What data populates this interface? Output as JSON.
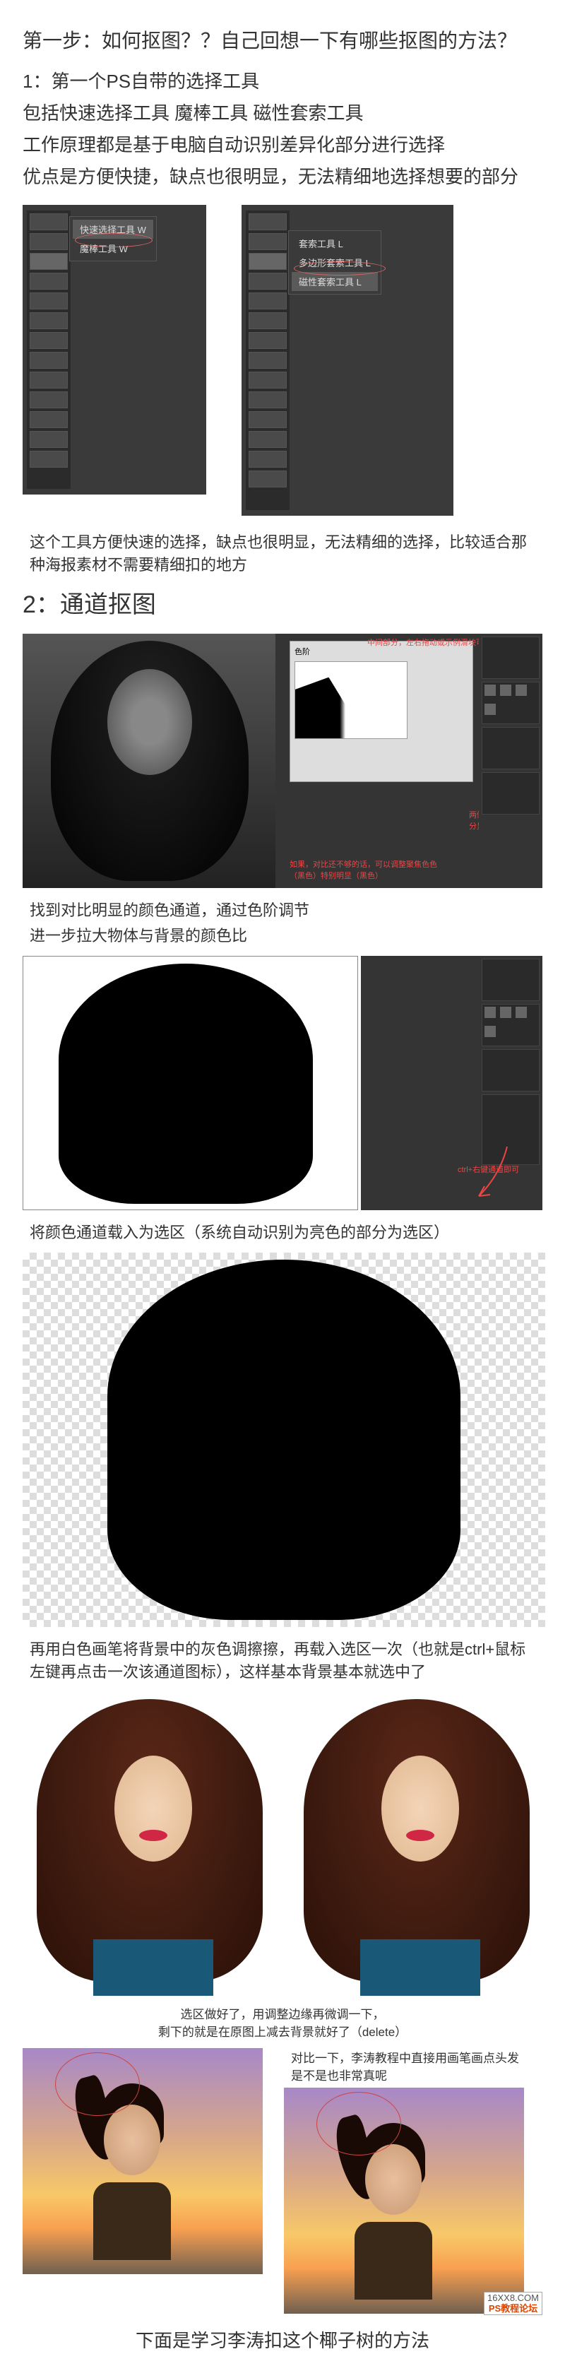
{
  "heading": "第一步：如何抠图？？自己回想一下有哪些抠图的方法？",
  "intro": {
    "line1": "1：第一个PS自带的选择工具",
    "line2": "包括快速选择工具 魔棒工具 磁性套索工具",
    "line3": "工作原理都是基于电脑自动识别差异化部分进行选择",
    "line4": "优点是方便快捷，缺点也很明显，无法精细地选择想要的部分"
  },
  "flyout1": {
    "item1": "快速选择工具  W",
    "item2": "魔棒工具      W"
  },
  "flyout2": {
    "item1": "套索工具      L",
    "item2": "多边形套索工具 L",
    "item3": "磁性套索工具   L"
  },
  "caption1": "这个工具方便快速的选择，缺点也很明显，无法精细的选择，比较适合那种海报素材不需要精细扣的地方",
  "section2_title": "2：通道抠图",
  "curves_label": "色阶",
  "annotation1_top": "中间部分，左右拖动或示例滑块可以调整颜色比",
  "annotation1_bottom": "两侧，左拖动则白部分显示更多",
  "annotation2": "如果，对比还不够的话，可以调整聚焦色色（黑色）特别明显（黑色）",
  "caption2": "找到对比明显的颜色通道，通过色阶调节",
  "caption2b": "进一步拉大物体与背景的颜色比",
  "annotation_silh": "ctrl+右键通道即可",
  "caption3": "将颜色通道载入为选区（系统自动识别为亮色的部分为选区）",
  "caption4": "再用白色画笔将背景中的灰色调擦擦，再载入选区一次（也就是ctrl+鼠标左键再点击一次该通道图标），这样基本背景基本就选中了",
  "caption5": "选区做好了，用调整边缘再微调一下，",
  "caption5b": "剩下的就是在原图上减去背景就好了（delete）",
  "caption6": "对比一下，李涛教程中直接用画笔画点头发是不是也非常真呢",
  "watermark": {
    "top": "16XX8.COM",
    "bottom": "PS教程论坛"
  },
  "bottom": "下面是学习李涛扣这个椰子树的方法"
}
